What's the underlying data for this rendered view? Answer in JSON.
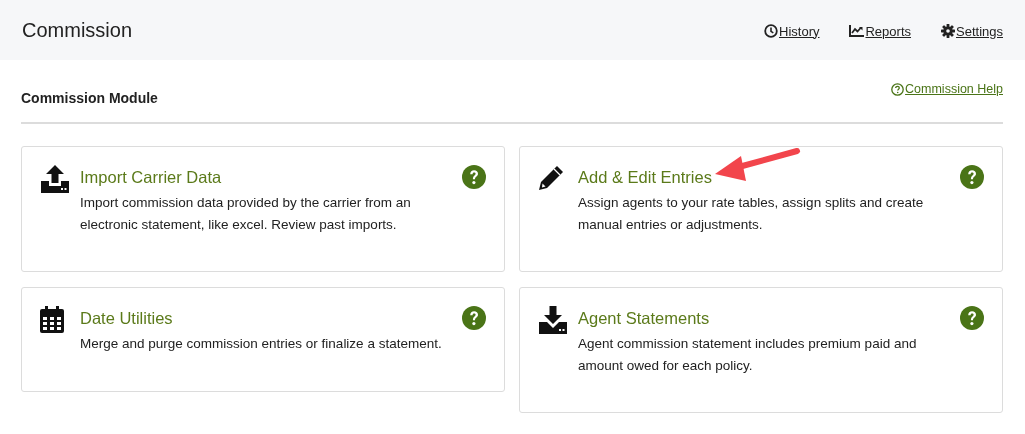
{
  "header": {
    "title": "Commission",
    "links": [
      "History",
      "Reports",
      "Settings"
    ]
  },
  "module": {
    "title": "Commission Module",
    "help_link": "Commission Help"
  },
  "cards": [
    {
      "title": "Import Carrier Data",
      "description": "Import commission data provided by the carrier from an electronic statement, like excel. Review past imports.",
      "annotated": false
    },
    {
      "title": "Add & Edit Entries",
      "description": "Assign agents to your rate tables, assign splits and create manual entries or adjustments.",
      "annotated": true
    },
    {
      "title": "Date Utilities",
      "description": "Merge and purge commission entries or finalize a statement.",
      "annotated": false
    },
    {
      "title": "Agent Statements",
      "description": "Agent commission statement includes premium paid and amount owed for each policy.",
      "annotated": false
    }
  ]
}
